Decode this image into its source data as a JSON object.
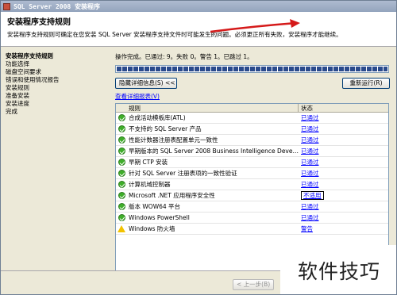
{
  "window": {
    "title": "SQL Server 2008 安装程序"
  },
  "header": {
    "title": "安装程序支持规则",
    "description": "安装程序支持规则可确定在您安装 SQL Server 安装程序支持文件时可能发生的问题。必须更正所有失败，安装程序才能继续。"
  },
  "nav": {
    "items": [
      {
        "label": "安装程序支持规则",
        "active": true
      },
      {
        "label": "功能选择"
      },
      {
        "label": "磁盘空间要求"
      },
      {
        "label": "错误和使用情况报告"
      },
      {
        "label": "安装规则"
      },
      {
        "label": "准备安装"
      },
      {
        "label": "安装进度"
      },
      {
        "label": "完成"
      }
    ]
  },
  "main": {
    "status_text": "操作完成。已通过: 9。失败 0。警告 1。已跳过 1。",
    "progress_percent": 100,
    "hide_details_label": "隐藏详细信息(S) <<",
    "rerun_label": "重新运行(R)",
    "view_report_label": "查看详细报表(V)",
    "grid": {
      "columns": [
        "规则",
        "状态"
      ],
      "rows": [
        {
          "rule": "合成活动模板库(ATL)",
          "status": "已通过",
          "icon": "ok"
        },
        {
          "rule": "不支持的 SQL Server 产品",
          "status": "已通过",
          "icon": "ok"
        },
        {
          "rule": "性能计数器注册表配置单元一致性",
          "status": "已通过",
          "icon": "ok"
        },
        {
          "rule": "早期版本的 SQL Server 2008 Business Intelligence Devel...",
          "status": "已通过",
          "icon": "ok"
        },
        {
          "rule": "早期 CTP 安装",
          "status": "已通过",
          "icon": "ok"
        },
        {
          "rule": "针对 SQL Server 注册表项的一致性验证",
          "status": "已通过",
          "icon": "ok"
        },
        {
          "rule": "计算机域控制器",
          "status": "已通过",
          "icon": "ok"
        },
        {
          "rule": "Microsoft .NET 应用程序安全性",
          "status": "不适用",
          "icon": "ok"
        },
        {
          "rule": "版本 WOW64 平台",
          "status": "已通过",
          "icon": "ok"
        },
        {
          "rule": "Windows PowerShell",
          "status": "已通过",
          "icon": "ok"
        },
        {
          "rule": "Windows 防火墙",
          "status": "警告",
          "icon": "warning"
        }
      ]
    }
  },
  "footer": {
    "back_label": "< 上一步(B)"
  },
  "watermark": {
    "text": "软件技巧"
  }
}
